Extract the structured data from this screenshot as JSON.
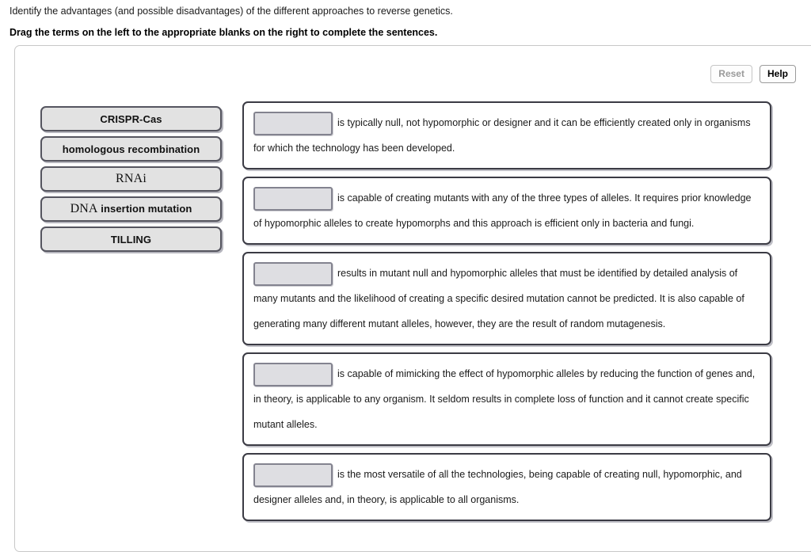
{
  "prompt": {
    "instruction": "Identify the advantages (and possible disadvantages) of the different approaches to reverse genetics.",
    "directive": "Drag the terms on the left to the appropriate blanks on the right to complete the sentences."
  },
  "toolbar": {
    "reset_label": "Reset",
    "help_label": "Help"
  },
  "terms_bank": {
    "items": [
      {
        "id": "crispr-cas",
        "label": "CRISPR-Cas",
        "style": "sans"
      },
      {
        "id": "homologous-recombination",
        "label": "homologous recombination",
        "style": "sans"
      },
      {
        "id": "rnai",
        "label": "RNAi",
        "style": "serif"
      },
      {
        "id": "dna-insertion-mutation",
        "label": "DNA insertion mutation",
        "style": "mixed",
        "serif_part": "DNA",
        "sans_part": " insertion mutation"
      },
      {
        "id": "tilling",
        "label": "TILLING",
        "style": "sans"
      }
    ]
  },
  "sentences": {
    "items": [
      {
        "id": "sentence-1",
        "blank_value": "",
        "text": "is typically null, not hypomorphic or designer and it can be efficiently created only in organisms for which the technology has been developed."
      },
      {
        "id": "sentence-2",
        "blank_value": "",
        "text": "is capable of creating mutants with any of the three types of alleles. It requires prior knowledge of hypomorphic alleles to create hypomorphs and this approach is efficient only in bacteria and fungi."
      },
      {
        "id": "sentence-3",
        "blank_value": "",
        "text": "results in mutant null and hypomorphic alleles that must be identified by detailed analysis of many mutants and the likelihood of creating a specific desired mutation cannot be predicted. It is also capable of generating many different mutant alleles, however, they are the result of random mutagenesis."
      },
      {
        "id": "sentence-4",
        "blank_value": "",
        "text": "is capable of mimicking the effect of hypomorphic alleles by reducing the function of genes and, in theory, is applicable to any organism. It seldom results in complete loss of function and it cannot create specific mutant alleles."
      },
      {
        "id": "sentence-5",
        "blank_value": "",
        "text": "is the most versatile of all the technologies, being capable of creating null, hypomorphic, and designer alleles and, in theory, is applicable to all organisms."
      }
    ]
  },
  "colors": {
    "chip_fill": "#e2e2e2",
    "chip_border": "#55555f",
    "blank_fill": "#dedee2",
    "blank_border": "#83838f",
    "sentence_border": "#3b3b44",
    "shell_border": "#c8c8c8"
  }
}
